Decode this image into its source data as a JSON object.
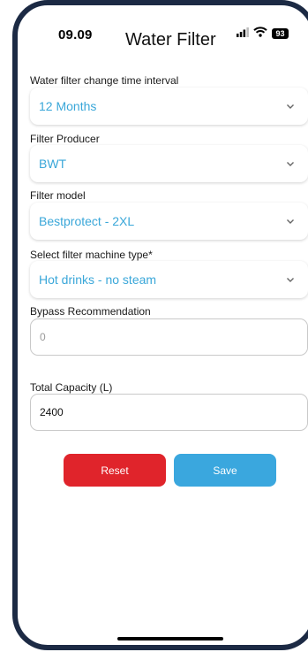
{
  "status_bar": {
    "time": "09.09",
    "battery": "93"
  },
  "header": {
    "title": "Water Filter"
  },
  "form": {
    "interval": {
      "label": "Water filter change time interval",
      "value": "12 Months"
    },
    "producer": {
      "label": "Filter Producer",
      "value": "BWT"
    },
    "model": {
      "label": "Filter model",
      "value": "Bestprotect - 2XL"
    },
    "machine_type": {
      "label": "Select filter machine type*",
      "value": "Hot drinks - no steam"
    },
    "bypass": {
      "label": "Bypass Recommendation",
      "value": "",
      "placeholder": "0"
    },
    "capacity": {
      "label": "Total Capacity (L)",
      "value": "2400"
    }
  },
  "actions": {
    "reset_label": "Reset",
    "save_label": "Save"
  },
  "colors": {
    "accent": "#3aa7d9",
    "reset": "#e0242b",
    "save": "#3aa7de",
    "bezel": "#1c2a44"
  },
  "icons": {
    "select_chevron": "chevron-down-icon",
    "signal": "signal-icon",
    "wifi": "wifi-icon",
    "battery": "battery-icon"
  }
}
